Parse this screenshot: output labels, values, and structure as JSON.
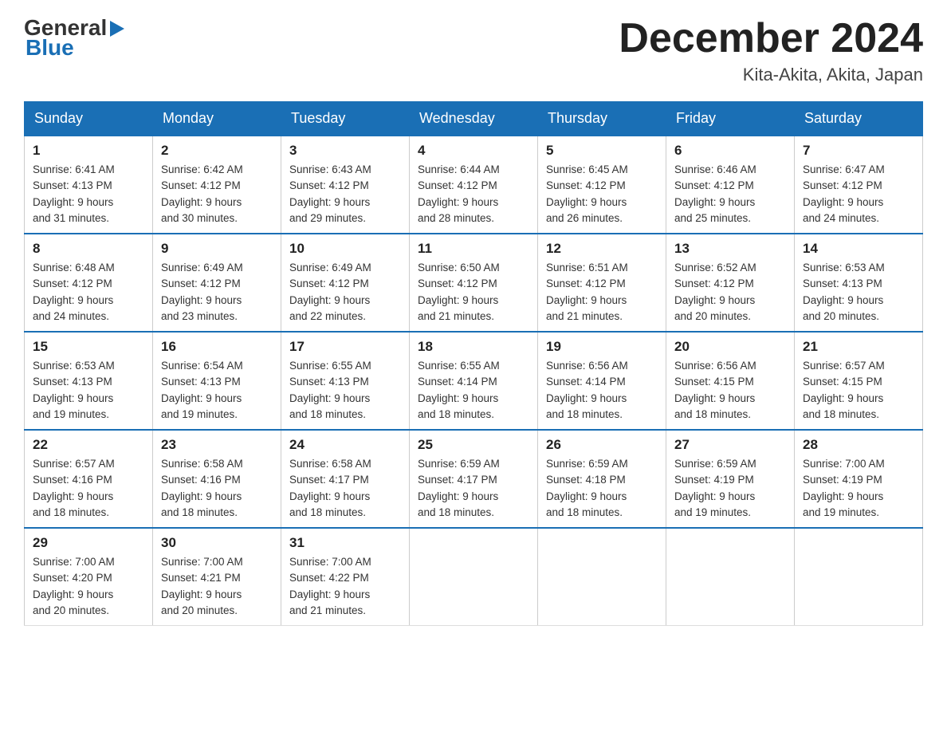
{
  "header": {
    "logo_general": "General",
    "logo_blue": "Blue",
    "title": "December 2024",
    "location": "Kita-Akita, Akita, Japan"
  },
  "days_of_week": [
    "Sunday",
    "Monday",
    "Tuesday",
    "Wednesday",
    "Thursday",
    "Friday",
    "Saturday"
  ],
  "weeks": [
    [
      {
        "day": "1",
        "sunrise": "6:41 AM",
        "sunset": "4:13 PM",
        "daylight": "9 hours and 31 minutes."
      },
      {
        "day": "2",
        "sunrise": "6:42 AM",
        "sunset": "4:12 PM",
        "daylight": "9 hours and 30 minutes."
      },
      {
        "day": "3",
        "sunrise": "6:43 AM",
        "sunset": "4:12 PM",
        "daylight": "9 hours and 29 minutes."
      },
      {
        "day": "4",
        "sunrise": "6:44 AM",
        "sunset": "4:12 PM",
        "daylight": "9 hours and 28 minutes."
      },
      {
        "day": "5",
        "sunrise": "6:45 AM",
        "sunset": "4:12 PM",
        "daylight": "9 hours and 26 minutes."
      },
      {
        "day": "6",
        "sunrise": "6:46 AM",
        "sunset": "4:12 PM",
        "daylight": "9 hours and 25 minutes."
      },
      {
        "day": "7",
        "sunrise": "6:47 AM",
        "sunset": "4:12 PM",
        "daylight": "9 hours and 24 minutes."
      }
    ],
    [
      {
        "day": "8",
        "sunrise": "6:48 AM",
        "sunset": "4:12 PM",
        "daylight": "9 hours and 24 minutes."
      },
      {
        "day": "9",
        "sunrise": "6:49 AM",
        "sunset": "4:12 PM",
        "daylight": "9 hours and 23 minutes."
      },
      {
        "day": "10",
        "sunrise": "6:49 AM",
        "sunset": "4:12 PM",
        "daylight": "9 hours and 22 minutes."
      },
      {
        "day": "11",
        "sunrise": "6:50 AM",
        "sunset": "4:12 PM",
        "daylight": "9 hours and 21 minutes."
      },
      {
        "day": "12",
        "sunrise": "6:51 AM",
        "sunset": "4:12 PM",
        "daylight": "9 hours and 21 minutes."
      },
      {
        "day": "13",
        "sunrise": "6:52 AM",
        "sunset": "4:12 PM",
        "daylight": "9 hours and 20 minutes."
      },
      {
        "day": "14",
        "sunrise": "6:53 AM",
        "sunset": "4:13 PM",
        "daylight": "9 hours and 20 minutes."
      }
    ],
    [
      {
        "day": "15",
        "sunrise": "6:53 AM",
        "sunset": "4:13 PM",
        "daylight": "9 hours and 19 minutes."
      },
      {
        "day": "16",
        "sunrise": "6:54 AM",
        "sunset": "4:13 PM",
        "daylight": "9 hours and 19 minutes."
      },
      {
        "day": "17",
        "sunrise": "6:55 AM",
        "sunset": "4:13 PM",
        "daylight": "9 hours and 18 minutes."
      },
      {
        "day": "18",
        "sunrise": "6:55 AM",
        "sunset": "4:14 PM",
        "daylight": "9 hours and 18 minutes."
      },
      {
        "day": "19",
        "sunrise": "6:56 AM",
        "sunset": "4:14 PM",
        "daylight": "9 hours and 18 minutes."
      },
      {
        "day": "20",
        "sunrise": "6:56 AM",
        "sunset": "4:15 PM",
        "daylight": "9 hours and 18 minutes."
      },
      {
        "day": "21",
        "sunrise": "6:57 AM",
        "sunset": "4:15 PM",
        "daylight": "9 hours and 18 minutes."
      }
    ],
    [
      {
        "day": "22",
        "sunrise": "6:57 AM",
        "sunset": "4:16 PM",
        "daylight": "9 hours and 18 minutes."
      },
      {
        "day": "23",
        "sunrise": "6:58 AM",
        "sunset": "4:16 PM",
        "daylight": "9 hours and 18 minutes."
      },
      {
        "day": "24",
        "sunrise": "6:58 AM",
        "sunset": "4:17 PM",
        "daylight": "9 hours and 18 minutes."
      },
      {
        "day": "25",
        "sunrise": "6:59 AM",
        "sunset": "4:17 PM",
        "daylight": "9 hours and 18 minutes."
      },
      {
        "day": "26",
        "sunrise": "6:59 AM",
        "sunset": "4:18 PM",
        "daylight": "9 hours and 18 minutes."
      },
      {
        "day": "27",
        "sunrise": "6:59 AM",
        "sunset": "4:19 PM",
        "daylight": "9 hours and 19 minutes."
      },
      {
        "day": "28",
        "sunrise": "7:00 AM",
        "sunset": "4:19 PM",
        "daylight": "9 hours and 19 minutes."
      }
    ],
    [
      {
        "day": "29",
        "sunrise": "7:00 AM",
        "sunset": "4:20 PM",
        "daylight": "9 hours and 20 minutes."
      },
      {
        "day": "30",
        "sunrise": "7:00 AM",
        "sunset": "4:21 PM",
        "daylight": "9 hours and 20 minutes."
      },
      {
        "day": "31",
        "sunrise": "7:00 AM",
        "sunset": "4:22 PM",
        "daylight": "9 hours and 21 minutes."
      },
      null,
      null,
      null,
      null
    ]
  ],
  "labels": {
    "sunrise": "Sunrise:",
    "sunset": "Sunset:",
    "daylight": "Daylight:"
  }
}
